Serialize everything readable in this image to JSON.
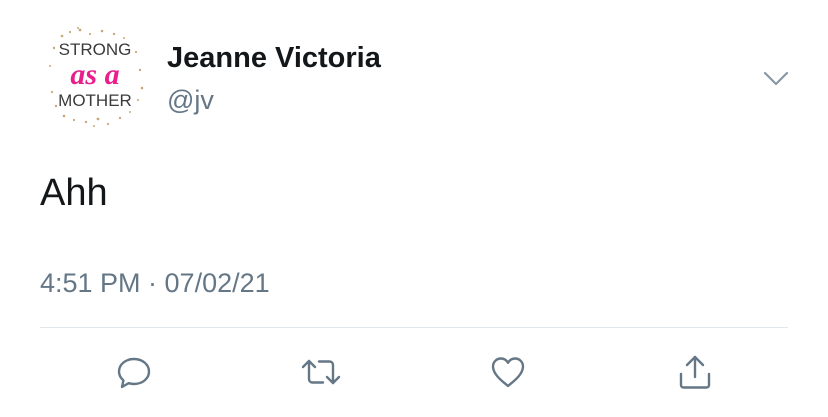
{
  "tweet": {
    "author": {
      "display_name": "Jeanne Victoria",
      "handle": "@jv",
      "avatar": {
        "line1": "STRONG",
        "line2": "as a",
        "line3": "MOTHER",
        "accent_color": "#e91e8c",
        "dot_color": "#c8a878"
      }
    },
    "text": "Ahh",
    "timestamp": "4:51 PM · 07/02/21"
  },
  "icons": {
    "more": "chevron-down-icon",
    "reply": "reply-icon",
    "retweet": "retweet-icon",
    "like": "heart-icon",
    "share": "share-icon"
  },
  "colors": {
    "text": "#14171a",
    "secondary": "#657786",
    "divider": "#e1e8ed"
  }
}
